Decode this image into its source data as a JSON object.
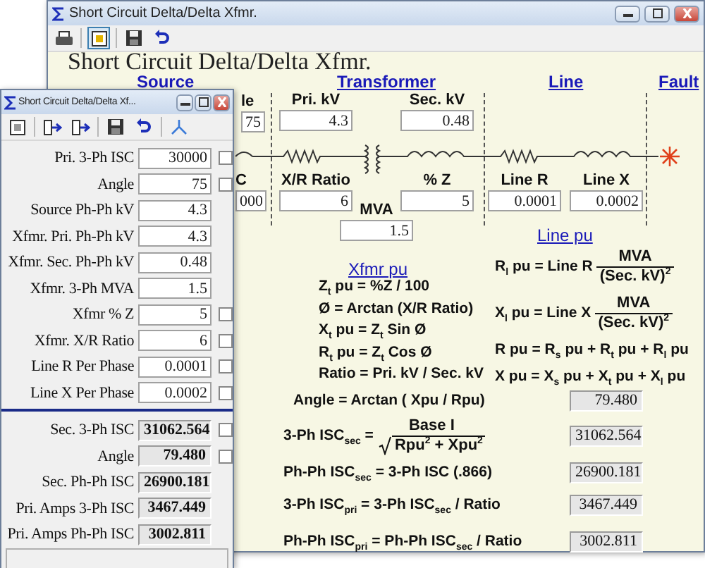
{
  "main_window": {
    "title": "Short Circuit Delta/Delta Xfmr.",
    "heading": "Short Circuit Delta/Delta Xfmr.",
    "section_headers": [
      "Source",
      "Transformer",
      "Line",
      "Fault"
    ],
    "fields": [
      {
        "label": "le",
        "value": "75"
      },
      {
        "label": "Pri. kV",
        "value": "4.3"
      },
      {
        "label": "Sec. kV",
        "value": "0.48"
      },
      {
        "label": "C",
        "value": "000"
      },
      {
        "label": "X/R Ratio",
        "value": "6"
      },
      {
        "label": "% Z",
        "value": "5"
      },
      {
        "label": "Line R",
        "value": "0.0001"
      },
      {
        "label": "Line X",
        "value": "0.0002"
      },
      {
        "label": "MVA",
        "value": "1.5"
      }
    ],
    "line_pu_link": "Line pu",
    "xfmr_pu_link": "Xfmr pu",
    "xfmr_formulas": [
      "Z$_{t}$ pu = %Z / 100",
      "Ø = Arctan (X/R Ratio)",
      "X$_{t}$ pu = Z$_{t}$ Sin Ø",
      "R$_{t}$ pu = Z$_{t}$ Cos Ø",
      "Ratio = Pri. kV / Sec. kV"
    ],
    "line_formulas": [
      {
        "kind": "fraction",
        "lhs": "R$_{l}$ pu = Line R",
        "numerator": "MVA",
        "denominator": "(Sec. kV)$^{2}$"
      },
      {
        "kind": "fraction",
        "lhs": "X$_{l}$ pu = Line X",
        "numerator": "MVA",
        "denominator": "(Sec. kV)$^{2}$"
      },
      {
        "kind": "text",
        "text": "R pu = R$_{s}$ pu + R$_{t}$ pu + R$_{l}$ pu"
      },
      {
        "kind": "text",
        "text": "X pu = X$_{s}$ pu + X$_{t}$ pu + X$_{l}$ pu"
      }
    ],
    "results": [
      {
        "kind": "text",
        "formula": "Angle = Arctan ( Xpu / Rpu)",
        "value": "79.480"
      },
      {
        "kind": "root_fraction",
        "lhs": "3-Ph ISC$_{sec}$ =",
        "numerator": "Base I",
        "denominator": "Rpu$^{2}$ + Xpu$^{2}$",
        "value": "31062.564"
      },
      {
        "kind": "text",
        "formula": "Ph-Ph ISC$_{sec}$ = 3-Ph ISC (.866)",
        "value": "26900.181"
      },
      {
        "kind": "text",
        "formula": "3-Ph ISC$_{pri}$ = 3-Ph ISC$_{sec}$ / Ratio",
        "value": "3467.449"
      },
      {
        "kind": "text",
        "formula": "Ph-Ph ISC$_{pri}$ = Ph-Ph ISC$_{sec}$ / Ratio",
        "value": "3002.811"
      }
    ]
  },
  "input_window": {
    "title": "Short Circuit Delta/Delta Xf...",
    "inputs": [
      {
        "label": "Pri. 3-Ph ISC",
        "value": "30000",
        "checked": false
      },
      {
        "label": "Angle",
        "value": "75",
        "checked": false
      },
      {
        "label": "Source Ph-Ph kV",
        "value": "4.3"
      },
      {
        "label": "Xfmr. Pri. Ph-Ph kV",
        "value": "4.3"
      },
      {
        "label": "Xfmr. Sec. Ph-Ph kV",
        "value": "0.48"
      },
      {
        "label": "Xfmr. 3-Ph MVA",
        "value": "1.5"
      },
      {
        "label": "Xfmr % Z",
        "value": "5",
        "checked": false
      },
      {
        "label": "Xfmr. X/R Ratio",
        "value": "6",
        "checked": false
      },
      {
        "label": "Line R Per Phase",
        "value": "0.0001",
        "checked": false
      },
      {
        "label": "Line X Per Phase",
        "value": "0.0002",
        "checked": false
      }
    ],
    "outputs": [
      {
        "label": "Sec. 3-Ph ISC",
        "value": "31062.564",
        "checked": false
      },
      {
        "label": "Angle",
        "value": "79.480",
        "checked": false
      },
      {
        "label": "Sec. Ph-Ph ISC",
        "value": "26900.181"
      },
      {
        "label": "Pri. Amps 3-Ph ISC",
        "value": "3467.449"
      },
      {
        "label": "Pri. Amps Ph-Ph ISC",
        "value": "3002.811"
      }
    ]
  }
}
